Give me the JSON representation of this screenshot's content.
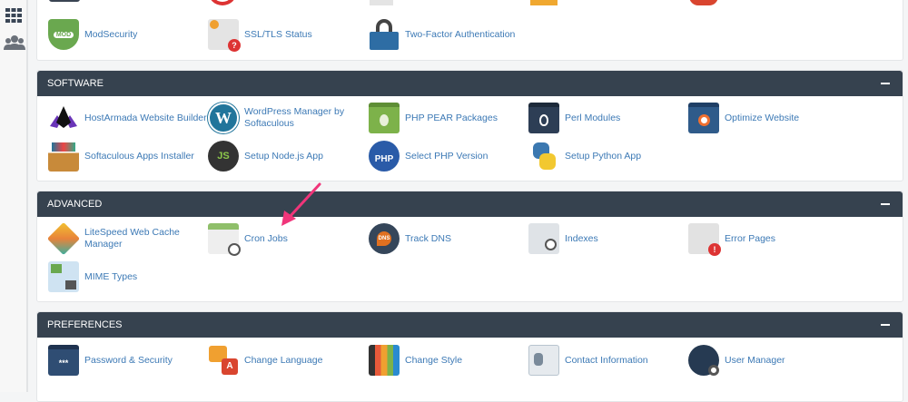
{
  "sidebar": {
    "items": [
      {
        "icon": "grid-icon"
      },
      {
        "icon": "users-icon"
      }
    ]
  },
  "security": {
    "items": [
      {
        "label": "ModSecurity",
        "icon": "shield-mod-icon",
        "color": "#6aa84f"
      },
      {
        "label": "SSL/TLS Status",
        "icon": "certificate-question-icon",
        "color": "#e0e0e0"
      },
      {
        "label": "Two-Factor Authentication",
        "icon": "padlock-icon",
        "color": "#2e6da4"
      }
    ]
  },
  "software": {
    "title": "SOFTWARE",
    "items": [
      {
        "label": "HostArmada Website Builder",
        "icon": "hostarmada-icon",
        "color": "#5b2d9b"
      },
      {
        "label": "WordPress Manager by Softaculous",
        "icon": "wordpress-icon",
        "color": "#21759b"
      },
      {
        "label": "PHP PEAR Packages",
        "icon": "pear-icon",
        "color": "#7db24a"
      },
      {
        "label": "Perl Modules",
        "icon": "perl-onion-icon",
        "color": "#2d3e55"
      },
      {
        "label": "Optimize Website",
        "icon": "optimize-magnifier-icon",
        "color": "#2f5b8a"
      },
      {
        "label": "Softaculous Apps Installer",
        "icon": "softaculous-icon",
        "color": "#c88a3a"
      },
      {
        "label": "Setup Node.js App",
        "icon": "nodejs-icon",
        "color": "#333"
      },
      {
        "label": "Select PHP Version",
        "icon": "php-icon",
        "color": "#2a5ba8"
      },
      {
        "label": "Setup Python App",
        "icon": "python-icon",
        "color": "#3b78b0"
      }
    ]
  },
  "advanced": {
    "title": "ADVANCED",
    "items": [
      {
        "label": "LiteSpeed Web Cache Manager",
        "icon": "litespeed-icon",
        "color": "#e8833a"
      },
      {
        "label": "Cron Jobs",
        "icon": "calendar-clock-icon",
        "color": "#8fbf6a"
      },
      {
        "label": "Track DNS",
        "icon": "dns-pin-icon",
        "color": "#e07020"
      },
      {
        "label": "Indexes",
        "icon": "folder-search-icon",
        "color": "#c9ced4"
      },
      {
        "label": "Error Pages",
        "icon": "error-page-icon",
        "color": "#d8d8d8"
      },
      {
        "label": "MIME Types",
        "icon": "mime-types-icon",
        "color": "#cfe3f2"
      }
    ]
  },
  "preferences": {
    "title": "PREFERENCES",
    "items": [
      {
        "label": "Password & Security",
        "icon": "password-icon",
        "color": "#2f4d73"
      },
      {
        "label": "Change Language",
        "icon": "language-icon",
        "color": "#f0a030"
      },
      {
        "label": "Change Style",
        "icon": "palette-icon",
        "color": "#e85a3a"
      },
      {
        "label": "Contact Information",
        "icon": "contact-card-icon",
        "color": "#b8c4cf"
      },
      {
        "label": "User Manager",
        "icon": "user-manager-icon",
        "color": "#263a52"
      }
    ]
  },
  "annotation": {
    "color": "#f0357a",
    "icon": "pink-arrow-icon"
  }
}
